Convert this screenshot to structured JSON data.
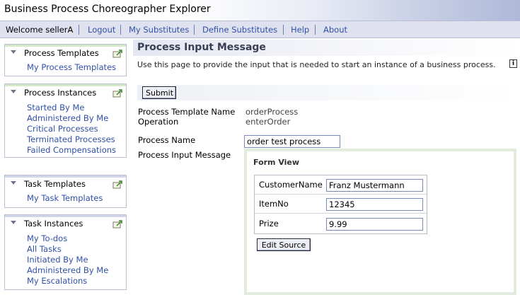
{
  "app": {
    "title": "Business Process Choreographer Explorer"
  },
  "nav": {
    "welcome": "Welcome sellerA",
    "links": [
      "Logout",
      "My Substitutes",
      "Define Substitutes",
      "Help",
      "About"
    ]
  },
  "sidebar": {
    "panels": [
      {
        "title": "Process Templates",
        "links": [
          "My Process Templates"
        ]
      },
      {
        "title": "Process Instances",
        "links": [
          "Started By Me",
          "Administered By Me",
          "Critical Processes",
          "Terminated Processes",
          "Failed Compensations"
        ]
      },
      {
        "title": "Task Templates",
        "links": [
          "My Task Templates"
        ]
      },
      {
        "title": "Task Instances",
        "links": [
          "My To-dos",
          "All Tasks",
          "Initiated By Me",
          "Administered By Me",
          "My Escalations"
        ]
      }
    ]
  },
  "main": {
    "heading": "Process Input Message",
    "description": "Use this page to provide the input that is needed to start an instance of a business process.",
    "info_icon": "i",
    "submit_label": "Submit",
    "template_label": "Process Template Name",
    "template_value": "orderProcess",
    "operation_label": "Operation",
    "operation_value": "enterOrder",
    "process_name_label": "Process Name",
    "process_name_value": "order test process",
    "input_message_label": "Process Input Message"
  },
  "form_view": {
    "title": "Form View",
    "fields": [
      {
        "label": "CustomerName",
        "value": "Franz Mustermann"
      },
      {
        "label": "ItemNo",
        "value": "12345"
      },
      {
        "label": "Prize",
        "value": "9.99"
      }
    ],
    "edit_source_label": "Edit Source"
  },
  "colors": {
    "link": "#3150a8",
    "navbar": "#dfe2ee",
    "form_border": "#e3ecdc"
  }
}
